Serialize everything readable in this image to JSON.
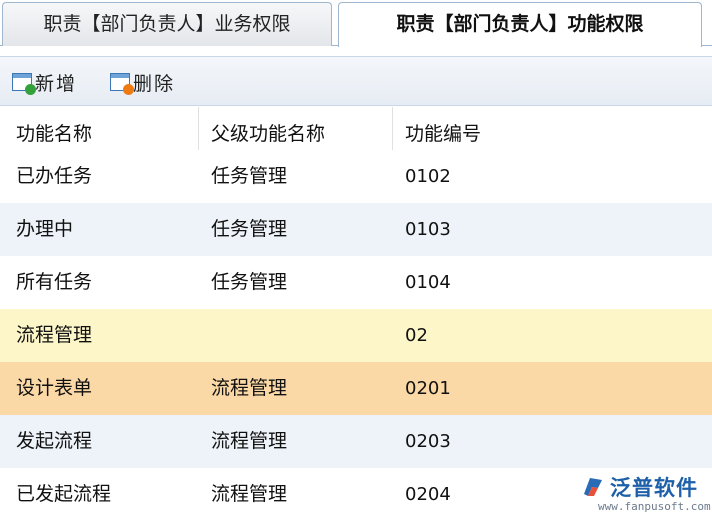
{
  "tabs": [
    {
      "label": "职责【部门负责人】业务权限",
      "active": false
    },
    {
      "label": "职责【部门负责人】功能权限",
      "active": true
    }
  ],
  "toolbar": {
    "add_label": "新增",
    "delete_label": "删除"
  },
  "grid": {
    "columns": [
      "功能名称",
      "父级功能名称",
      "功能编号"
    ],
    "rows": [
      {
        "name": "已办任务",
        "parent": "任务管理",
        "code": "0102",
        "state": "normal"
      },
      {
        "name": "办理中",
        "parent": "任务管理",
        "code": "0103",
        "state": "normal"
      },
      {
        "name": "所有任务",
        "parent": "任务管理",
        "code": "0104",
        "state": "normal"
      },
      {
        "name": "流程管理",
        "parent": "",
        "code": "02",
        "state": "hover"
      },
      {
        "name": "设计表单",
        "parent": "流程管理",
        "code": "0201",
        "state": "selected"
      },
      {
        "name": "发起流程",
        "parent": "流程管理",
        "code": "0203",
        "state": "normal"
      },
      {
        "name": "已发起流程",
        "parent": "流程管理",
        "code": "0204",
        "state": "normal"
      }
    ]
  },
  "watermark": {
    "name": "泛普软件",
    "url": "www.fanpusoft.com"
  },
  "colors": {
    "hover_row": "#fdf6c8",
    "selected_row": "#fbd9a6",
    "alt_row": "#eef3fa",
    "brand": "#1d5fa8"
  }
}
